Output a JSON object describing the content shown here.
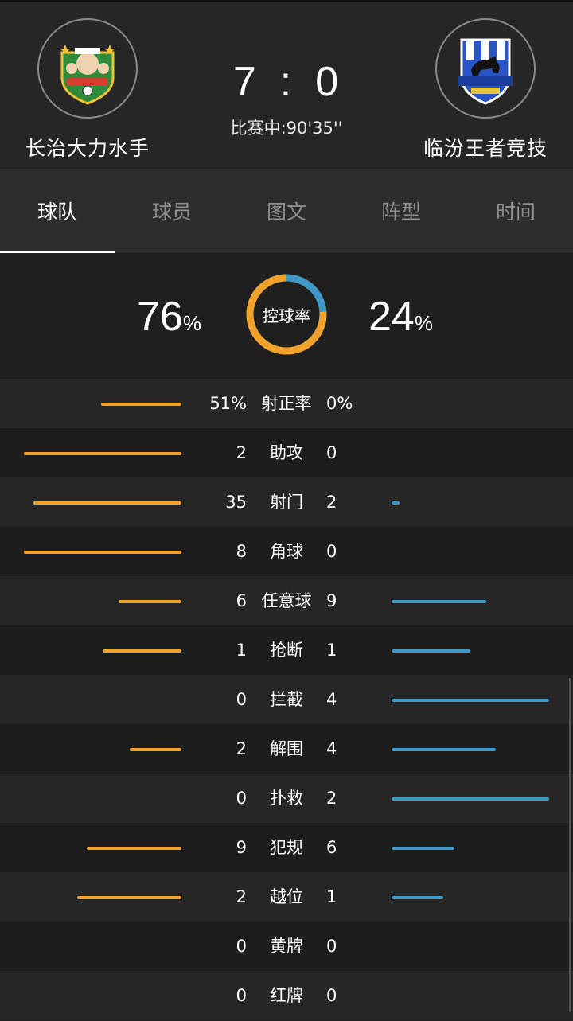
{
  "match": {
    "home_team": "长治大力水手",
    "away_team": "临汾王者竞技",
    "home_score": "7",
    "away_score": "0",
    "separator": ":",
    "status": "比赛中:90'35''"
  },
  "tabs": [
    {
      "label": "球队",
      "active": true
    },
    {
      "label": "球员",
      "active": false
    },
    {
      "label": "图文",
      "active": false
    },
    {
      "label": "阵型",
      "active": false
    },
    {
      "label": "时间",
      "active": false
    }
  ],
  "possession": {
    "label": "控球率",
    "home_value": "76",
    "away_value": "24",
    "unit": "%",
    "home_fraction": 0.76,
    "home_color": "#f0a22b",
    "away_color": "#3f98c5"
  },
  "stats": [
    {
      "label": "射正率",
      "home": "51%",
      "away": "0%",
      "home_bar": 0.51,
      "away_bar": 0
    },
    {
      "label": "助攻",
      "home": "2",
      "away": "0",
      "home_bar": 1,
      "away_bar": 0
    },
    {
      "label": "射门",
      "home": "35",
      "away": "2",
      "home_bar": 0.94,
      "away_bar": 0.05
    },
    {
      "label": "角球",
      "home": "8",
      "away": "0",
      "home_bar": 1,
      "away_bar": 0
    },
    {
      "label": "任意球",
      "home": "6",
      "away": "9",
      "home_bar": 0.4,
      "away_bar": 0.6
    },
    {
      "label": "抢断",
      "home": "1",
      "away": "1",
      "home_bar": 0.5,
      "away_bar": 0.5
    },
    {
      "label": "拦截",
      "home": "0",
      "away": "4",
      "home_bar": 0,
      "away_bar": 1
    },
    {
      "label": "解围",
      "home": "2",
      "away": "4",
      "home_bar": 0.33,
      "away_bar": 0.66
    },
    {
      "label": "扑救",
      "home": "0",
      "away": "2",
      "home_bar": 0,
      "away_bar": 1
    },
    {
      "label": "犯规",
      "home": "9",
      "away": "6",
      "home_bar": 0.6,
      "away_bar": 0.4
    },
    {
      "label": "越位",
      "home": "2",
      "away": "1",
      "home_bar": 0.66,
      "away_bar": 0.33
    },
    {
      "label": "黄牌",
      "home": "0",
      "away": "0",
      "home_bar": 0,
      "away_bar": 0
    },
    {
      "label": "红牌",
      "home": "0",
      "away": "0",
      "home_bar": 0,
      "away_bar": 0
    }
  ]
}
